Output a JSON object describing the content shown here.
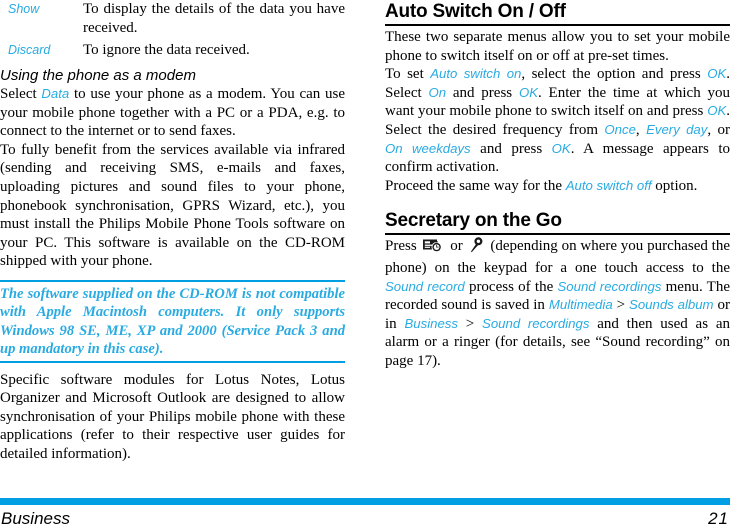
{
  "left_column": {
    "definitions": [
      {
        "term": "Show",
        "description": "To display the details of the data you have received."
      },
      {
        "term": "Discard",
        "description": "To ignore the data received."
      }
    ],
    "subsection_title": "Using the phone as a modem",
    "paragraph_1": {
      "part_1": "Select ",
      "ui_1": "Data",
      "part_2": " to use your phone as a modem. You can use your mobile phone together with a PC or a PDA, e.g. to connect to the internet or to send faxes."
    },
    "paragraph_2": "To fully benefit from the services available via infrared (sending and receiving SMS, e-mails and faxes, uploading pictures and sound files to your phone, phonebook synchronisation, GPRS Wizard, etc.), you must install the Philips Mobile Phone Tools software on your PC. This software is available on the CD-ROM shipped with your phone.",
    "note": "The software supplied on the CD-ROM is not compatible with Apple Macintosh computers. It only supports Windows 98 SE, ME, XP and 2000 (Service Pack 3 and up mandatory in this case).",
    "paragraph_3": "Specific software modules for Lotus Notes, Lotus Organizer and Microsoft Outlook are designed to allow synchronisation of your Philips mobile phone with these applications (refer to their respective user guides for detailed information)."
  },
  "right_column": {
    "section_1": {
      "title": "Auto Switch On / Off",
      "paragraph_1": "These two separate menus allow you to set your mobile phone to switch itself on or off at pre-set times.",
      "paragraph_2": {
        "s1": "To set ",
        "ui1": "Auto switch on",
        "s2": ", select the option and press ",
        "ui2": "OK",
        "s3": ". Select ",
        "ui3": "On",
        "s4": " and press ",
        "ui4": "OK",
        "s5": ". Enter the time at which you want your mobile phone to switch itself on and press ",
        "ui5": "OK",
        "s6": ". Select the desired frequency from ",
        "ui6": "Once",
        "s7": ", ",
        "ui7": "Every day",
        "s8": ", or ",
        "ui8": "On weekdays",
        "s9": " and press ",
        "ui9": "OK",
        "s10": ". A message appears to confirm activation."
      },
      "paragraph_3": {
        "s1": "Proceed the same way for the ",
        "ui1": "Auto switch off",
        "s2": " option."
      }
    },
    "section_2": {
      "title": "Secretary on the Go",
      "icon_1_name": "camera-clock-icon",
      "icon_2_name": "microphone-icon",
      "paragraph": {
        "s1": "Press ",
        "s2": " or ",
        "s3": " (depending on where you purchased the phone) on the keypad for a one touch access to the ",
        "ui1": "Sound record",
        "s4": " process of the ",
        "ui2": "Sound recordings",
        "s5": " menu. The recorded sound is saved in ",
        "ui3": "Multimedia",
        "s6": " > ",
        "ui4": "Sounds album",
        "s7": " or in ",
        "ui5": "Business",
        "s8": " > ",
        "ui6": "Sound recordings",
        "s9": " and then used as an alarm or a ringer (for details, see “Sound recording” on page 17)."
      }
    }
  },
  "footer": {
    "section": "Business",
    "page_number": "21"
  },
  "colors": {
    "ui_blue": "#29ABE2",
    "rule_blue": "#009FE3",
    "text_black": "#000000"
  }
}
